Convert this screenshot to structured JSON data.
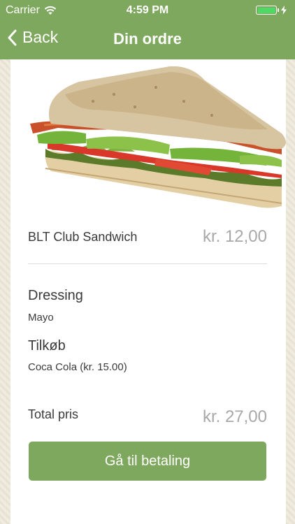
{
  "status_bar": {
    "carrier": "Carrier",
    "time": "4:59 PM",
    "battery_level": 1.0,
    "icons": [
      "wifi-icon",
      "battery-icon",
      "charging-bolt-icon"
    ]
  },
  "nav": {
    "back_label": "Back",
    "title": "Din ordre"
  },
  "order": {
    "image": "sandwich-photo",
    "item_name": "BLT Club Sandwich",
    "item_price": "kr. 12,00",
    "dressing_heading": "Dressing",
    "dressing_value": "Mayo",
    "addon_heading": "Tilkøb",
    "addon_value": "Coca Cola (kr. 15.00)",
    "total_label": "Total pris",
    "total_value": "kr. 27,00",
    "pay_button_label": "Gå til betaling"
  },
  "colors": {
    "brand_green": "#7fa85f",
    "battery_green": "#4cd964",
    "price_gray": "#a8a8a8",
    "text_dark": "#3a3a3a"
  }
}
